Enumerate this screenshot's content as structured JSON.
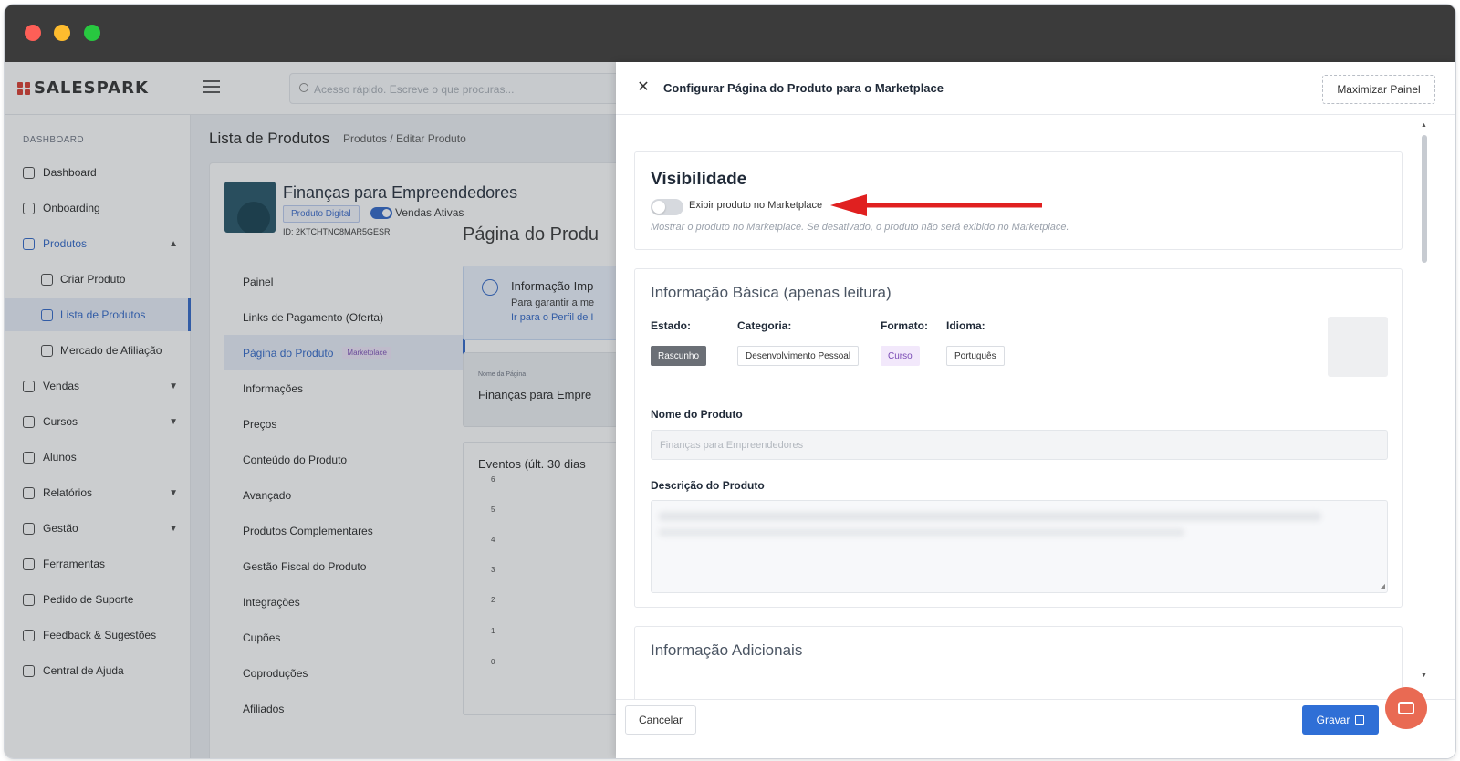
{
  "app": {
    "logo": "SALESPARK",
    "search_placeholder": "Acesso rápido. Escreve o que procuras..."
  },
  "sidebar": {
    "section": "DASHBOARD",
    "items": [
      {
        "label": "Dashboard",
        "icon": "dashboard-icon"
      },
      {
        "label": "Onboarding",
        "icon": "onboarding-icon"
      },
      {
        "label": "Produtos",
        "icon": "grid-icon",
        "expanded": true
      },
      {
        "label": "Criar Produto",
        "icon": "file-plus-icon"
      },
      {
        "label": "Lista de Produtos",
        "icon": "table-icon",
        "selected": true
      },
      {
        "label": "Mercado de Afiliação",
        "icon": "store-icon"
      },
      {
        "label": "Vendas",
        "icon": "cart-icon"
      },
      {
        "label": "Cursos",
        "icon": "monitor-icon"
      },
      {
        "label": "Alunos",
        "icon": "users-icon"
      },
      {
        "label": "Relatórios",
        "icon": "chart-icon"
      },
      {
        "label": "Gestão",
        "icon": "gear-icon"
      },
      {
        "label": "Ferramentas",
        "icon": "wrench-icon"
      },
      {
        "label": "Pedido de Suporte",
        "icon": "support-icon"
      },
      {
        "label": "Feedback & Sugestões",
        "icon": "feedback-icon"
      },
      {
        "label": "Central de Ajuda",
        "icon": "help-icon"
      }
    ]
  },
  "content": {
    "heading": "Lista de Produtos",
    "breadcrumb": "Produtos  /  Editar Produto",
    "product": {
      "title": "Finanças para Empreendedores",
      "type_badge": "Produto Digital",
      "sales_status": "Vendas Ativas",
      "id": "ID: 2KTCHTNC8MAR5GESR"
    },
    "submenu": [
      {
        "label": "Painel"
      },
      {
        "label": "Links de Pagamento (Oferta)"
      },
      {
        "label": "Página do Produto",
        "tag": "Marketplace",
        "selected": true
      },
      {
        "label": "Informações"
      },
      {
        "label": "Preços"
      },
      {
        "label": "Conteúdo do Produto"
      },
      {
        "label": "Avançado"
      },
      {
        "label": "Produtos Complementares"
      },
      {
        "label": "Gestão Fiscal do Produto"
      },
      {
        "label": "Integrações"
      },
      {
        "label": "Cupões"
      },
      {
        "label": "Coproduções"
      },
      {
        "label": "Afiliados"
      }
    ],
    "right_title": "Página do Produ",
    "info_box": {
      "title": "Informação Imp",
      "text": "Para garantir a me",
      "link": "Ir para o Perfil de I"
    },
    "page_name": {
      "label": "Nome da Página",
      "value": "Finanças para Empre"
    },
    "events": {
      "title": "Eventos (últ. 30 dias",
      "y_ticks": [
        "6",
        "5",
        "4",
        "3",
        "2",
        "1",
        "0"
      ]
    }
  },
  "drawer": {
    "title": "Configurar Página do Produto para o Marketplace",
    "maximize": "Maximizar Painel",
    "visibility": {
      "heading": "Visibilidade",
      "toggle_label": "Exibir produto no Marketplace",
      "toggle_on": false,
      "help": "Mostrar o produto no Marketplace. Se desativado, o produto não será exibido no Marketplace."
    },
    "basic_info": {
      "heading": "Informação Básica (apenas leitura)",
      "estado_label": "Estado:",
      "estado_value": "Rascunho",
      "categoria_label": "Categoria:",
      "categoria_value": "Desenvolvimento Pessoal",
      "formato_label": "Formato:",
      "formato_value": "Curso",
      "idioma_label": "Idioma:",
      "idioma_value": "Português",
      "nome_label": "Nome do Produto",
      "nome_placeholder": "Finanças para Empreendedores",
      "descricao_label": "Descrição do Produto"
    },
    "additional": {
      "heading": "Informação Adicionais"
    },
    "cancel": "Cancelar",
    "save": "Gravar"
  },
  "colors": {
    "primary": "#2f6fd6",
    "arrow": "#e02020",
    "chat": "#e96a53"
  }
}
